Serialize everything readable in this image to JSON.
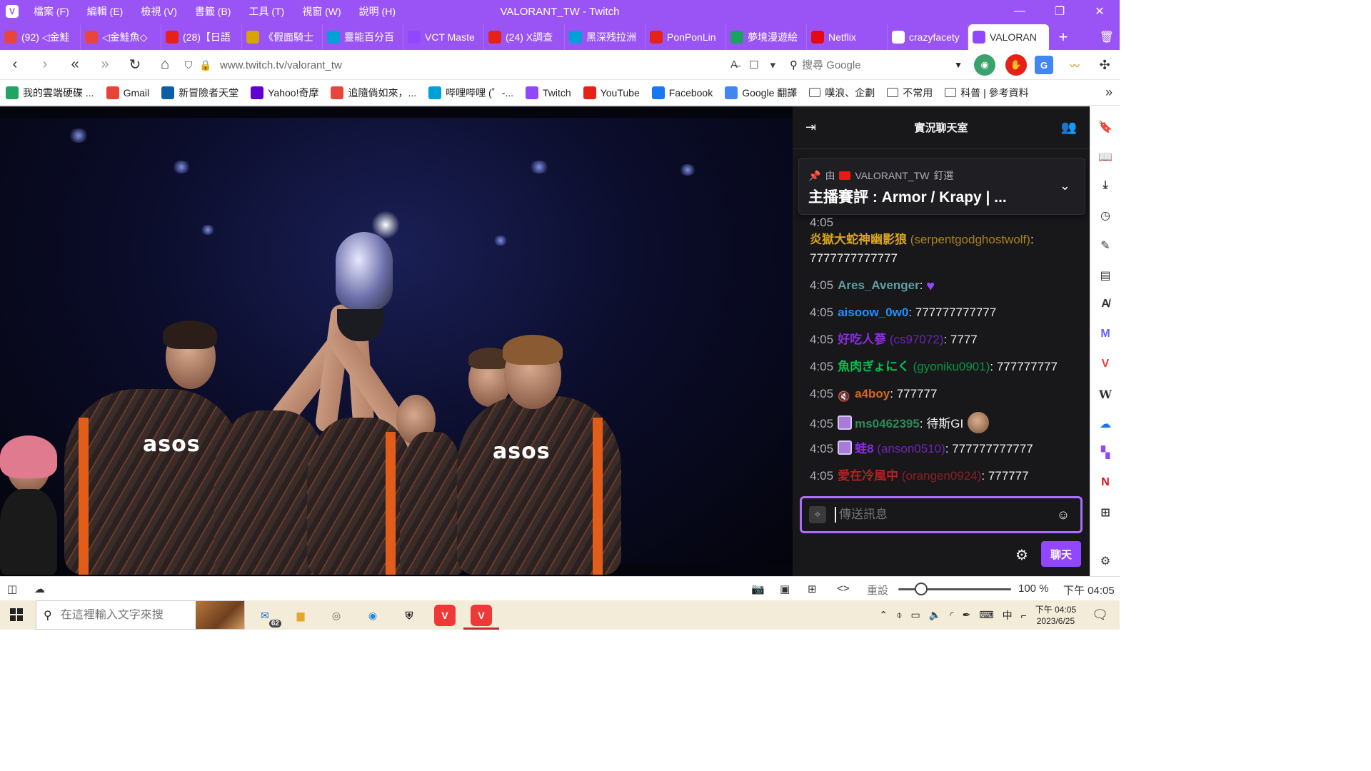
{
  "window": {
    "title": "VALORANT_TW - Twitch",
    "menu": [
      "檔案 (F)",
      "編輯 (E)",
      "檢視 (V)",
      "書籤 (B)",
      "工具 (T)",
      "視窗 (W)",
      "說明 (H)"
    ]
  },
  "tabs": [
    {
      "label": "(92) ◁金鮭",
      "color": "#e8463d"
    },
    {
      "label": "◁金鮭魚◇",
      "color": "#e8463d"
    },
    {
      "label": "(28)【日語",
      "color": "#e62117"
    },
    {
      "label": "《假面騎士",
      "color": "#d7a400"
    },
    {
      "label": "靈能百分百",
      "color": "#00a1d6"
    },
    {
      "label": "VCT Maste",
      "color": "#9147ff"
    },
    {
      "label": "(24) X調查",
      "color": "#e62117"
    },
    {
      "label": "黑深残拉洲",
      "color": "#00a1d6"
    },
    {
      "label": "PonPonLin",
      "color": "#e62117"
    },
    {
      "label": "夢境漫遊絵",
      "color": "#1aa260"
    },
    {
      "label": "Netflix",
      "color": "#e50914"
    },
    {
      "label": "crazyfacety",
      "color": "#ffffff"
    },
    {
      "label": "VALORAN",
      "color": "#9147ff"
    }
  ],
  "address": {
    "url": "www.twitch.tv/valorant_tw",
    "search_placeholder": "搜尋 Google"
  },
  "bookmarks": [
    {
      "label": "我的雲端硬碟 ...",
      "color": "#1fa463"
    },
    {
      "label": "Gmail",
      "color": "#ea4335"
    },
    {
      "label": "新冒險者天堂",
      "color": "#0b5ea8"
    },
    {
      "label": "Yahoo!奇摩",
      "color": "#6001d2"
    },
    {
      "label": "追隨倘如來，...",
      "color": "#e8463d"
    },
    {
      "label": "哔哩哔哩 (゜-...",
      "color": "#00a1d6"
    },
    {
      "label": "Twitch",
      "color": "#9147ff"
    },
    {
      "label": "YouTube",
      "color": "#e62117"
    },
    {
      "label": "Facebook",
      "color": "#1877f2"
    },
    {
      "label": "Google 翻譯",
      "color": "#4285f4"
    },
    {
      "label": "噗浪、企劃",
      "folder": true
    },
    {
      "label": "不常用",
      "folder": true
    },
    {
      "label": "科普 | 參考資料",
      "folder": true
    }
  ],
  "video": {
    "jersey_text": "asos"
  },
  "chat": {
    "title": "實況聊天室",
    "pinned": {
      "by_prefix": "由",
      "by_channel": "VALORANT_TW",
      "by_suffix": "釘選",
      "message": "主播賽評 : Armor / Krapy | ..."
    },
    "messages": [
      {
        "time": "4:05",
        "user": "",
        "login": "",
        "text": "",
        "top": 0
      },
      {
        "time": "",
        "user": "炎獄大蛇神幽影狼",
        "login": "(serpentgodghostwolf)",
        "text": "7777777777777",
        "color": "#daa520",
        "wrap": true
      },
      {
        "time": "4:05",
        "user": "Ares_Avenger",
        "login": "",
        "text": "",
        "color": "#5f9ea0",
        "emote": "heart"
      },
      {
        "time": "4:05",
        "user": "aisoow_0w0",
        "login": "",
        "text": "777777777777",
        "color": "#1e90ff"
      },
      {
        "time": "4:05",
        "user": "好吃人蔘",
        "login": "(cs97072)",
        "text": "7777",
        "color": "#8a2be2"
      },
      {
        "time": "4:05",
        "user": "魚肉ぎょにく",
        "login": "(gyoniku0901)",
        "text": "777777777",
        "color": "#00c150"
      },
      {
        "time": "4:05",
        "user": "a4boy",
        "login": "",
        "text": "777777",
        "color": "#d2691e",
        "badge": "mute"
      },
      {
        "time": "4:05",
        "user": "ms0462395",
        "login": "",
        "text": "待斯GI",
        "color": "#2e8b57",
        "badge": "sub",
        "emote": "face"
      },
      {
        "time": "4:05",
        "user": "蛙8",
        "login": "(anson0510)",
        "text": "777777777777",
        "color": "#8a2be2",
        "badge": "sub"
      },
      {
        "time": "4:05",
        "user": "愛在冷風中",
        "login": "(orangen0924)",
        "text": "777777",
        "color": "#b22222"
      }
    ],
    "input_placeholder": "傳送訊息",
    "send_label": "聊天"
  },
  "statusbar": {
    "reset_label": "重設",
    "zoom": "100 %",
    "zoom_fraction": 0.2,
    "clock": "下午 04:05"
  },
  "taskbar": {
    "search_placeholder": "在這裡輸入文字來搜",
    "mail_badge": "62",
    "ime": "中",
    "time": "下午 04:05",
    "date": "2023/6/25"
  },
  "colors": {
    "accent": "#9a54f5",
    "twitch": "#9147ff",
    "chat_bg": "#18181b"
  }
}
